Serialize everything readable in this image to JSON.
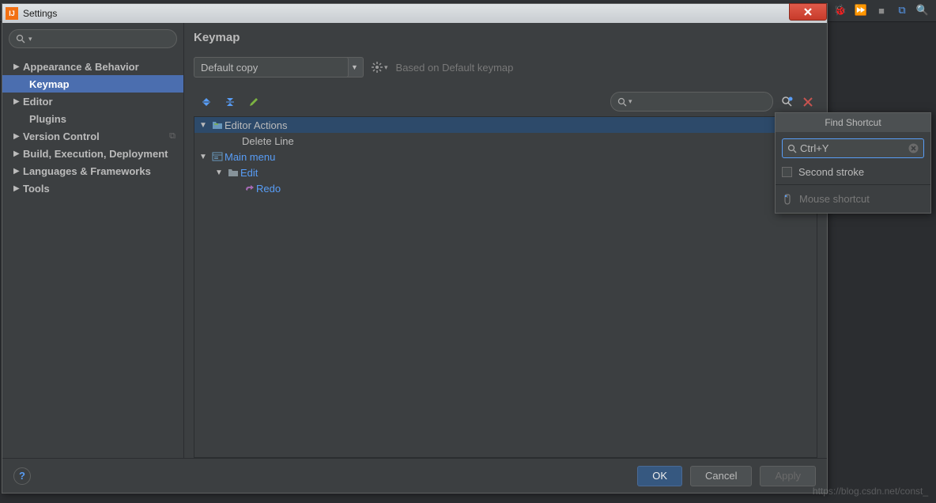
{
  "window": {
    "title": "Settings"
  },
  "sidebar": {
    "items": [
      {
        "label": "Appearance & Behavior",
        "expandable": true
      },
      {
        "label": "Keymap",
        "expandable": false,
        "selected": true
      },
      {
        "label": "Editor",
        "expandable": true
      },
      {
        "label": "Plugins",
        "expandable": false
      },
      {
        "label": "Version Control",
        "expandable": true,
        "copyable": true
      },
      {
        "label": "Build, Execution, Deployment",
        "expandable": true
      },
      {
        "label": "Languages & Frameworks",
        "expandable": true
      },
      {
        "label": "Tools",
        "expandable": true
      }
    ]
  },
  "main": {
    "title": "Keymap",
    "scheme_selected": "Default copy",
    "based_on_label": "Based on Default keymap"
  },
  "actions_tree": {
    "group1": "Editor Actions",
    "leaf1": "Delete Line",
    "group2": "Main menu",
    "group3": "Edit",
    "leaf2": "Redo"
  },
  "find_shortcut": {
    "title": "Find Shortcut",
    "input_value": "Ctrl+Y",
    "second_stroke_label": "Second stroke",
    "mouse_label": "Mouse shortcut"
  },
  "buttons": {
    "ok": "OK",
    "cancel": "Cancel",
    "apply": "Apply"
  },
  "watermark": "https://blog.csdn.net/const_"
}
